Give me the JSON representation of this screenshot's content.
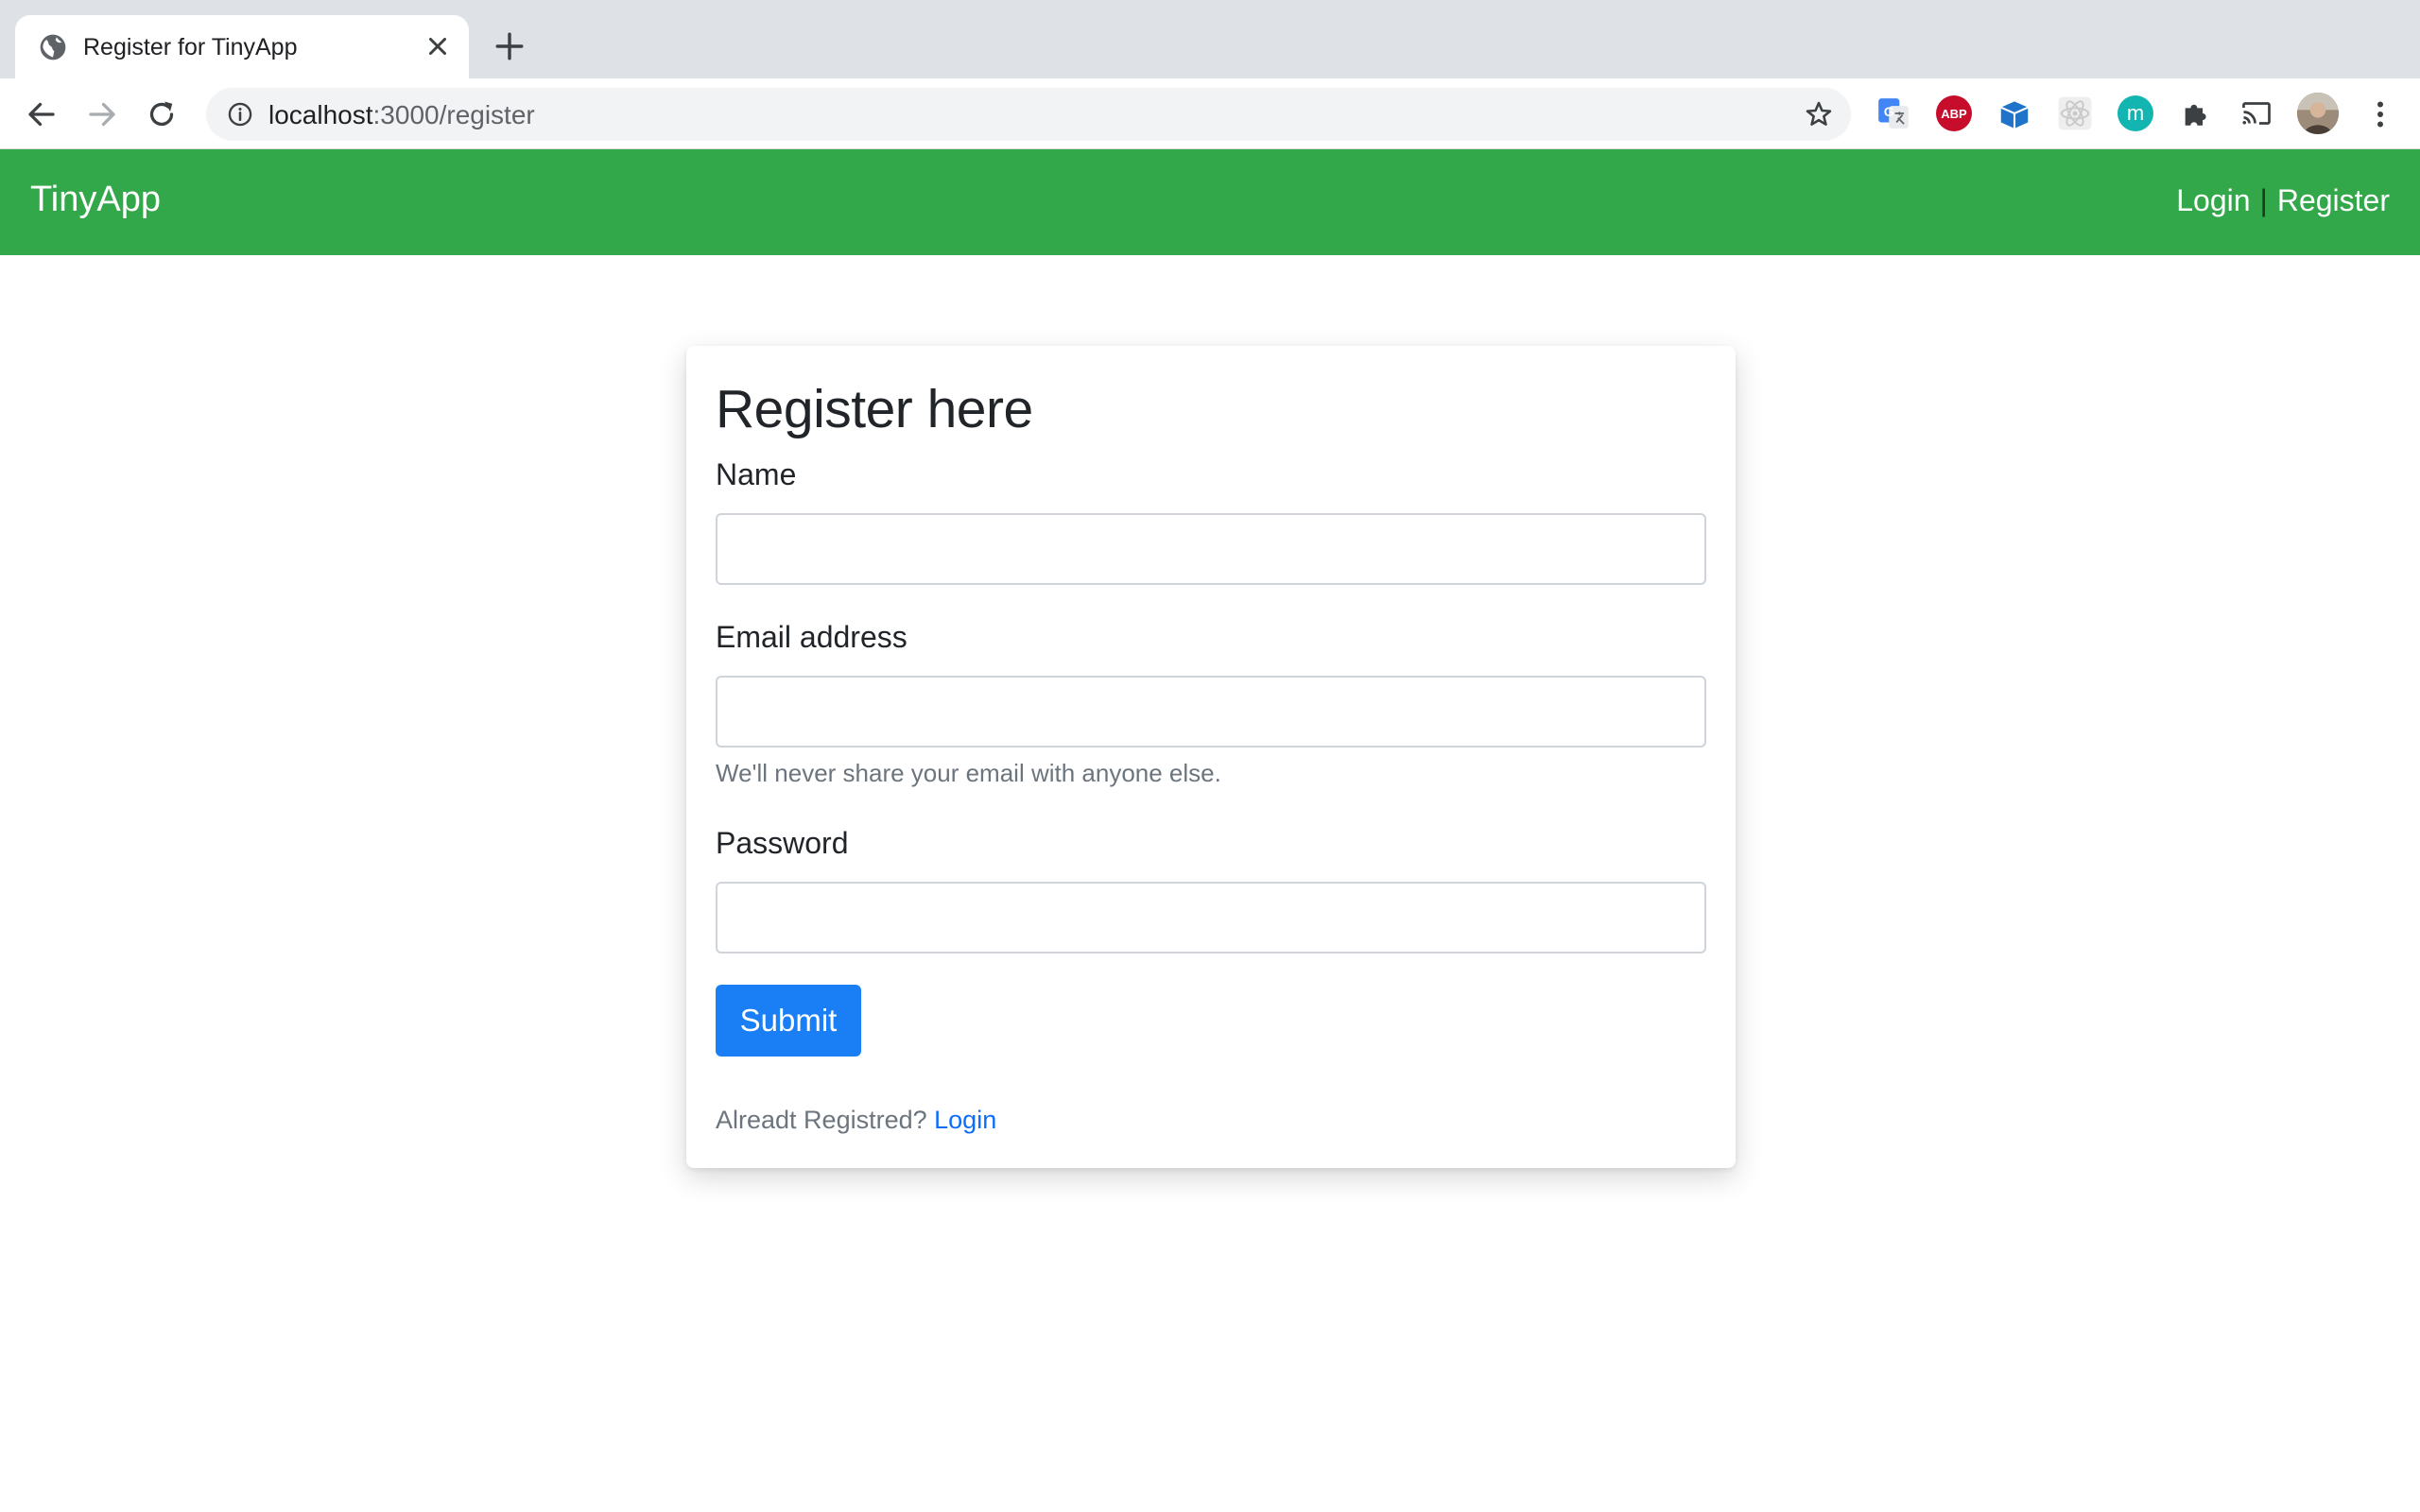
{
  "browser": {
    "tab_title": "Register for TinyApp",
    "url_host": "localhost",
    "url_rest": ":3000/register",
    "extensions": {
      "abp_label": "ABP",
      "m_label": "m"
    }
  },
  "navbar": {
    "brand": "TinyApp",
    "login_label": "Login",
    "separator": "|",
    "register_label": "Register",
    "color": "#33a84a"
  },
  "form": {
    "title": "Register here",
    "name_label": "Name",
    "name_value": "",
    "email_label": "Email address",
    "email_value": "",
    "email_help": "We'll never share your email with anyone else.",
    "password_label": "Password",
    "password_value": "",
    "submit_label": "Submit",
    "footer_prompt": "Alreadt Registred?",
    "footer_link": "Login",
    "accent_color": "#1a7ff5"
  }
}
